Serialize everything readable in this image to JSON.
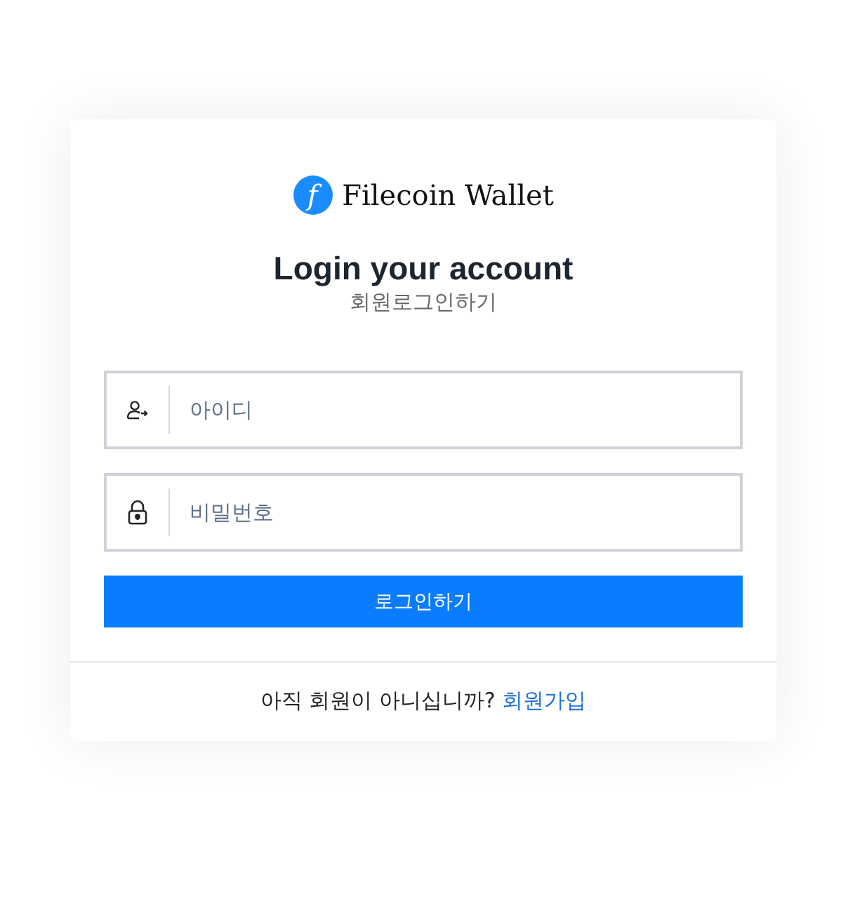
{
  "brand": {
    "name": "Filecoin Wallet",
    "logo_glyph": "f"
  },
  "heading": {
    "title": "Login your account",
    "subtitle": "회원로그인하기"
  },
  "fields": [
    {
      "kind": "user",
      "placeholder": "아이디"
    },
    {
      "kind": "lock",
      "placeholder": "비밀번호"
    }
  ],
  "submit_button": "로그인하기",
  "footer": {
    "text": "아직 회원이 아니십니까?",
    "link": "회원가입"
  }
}
